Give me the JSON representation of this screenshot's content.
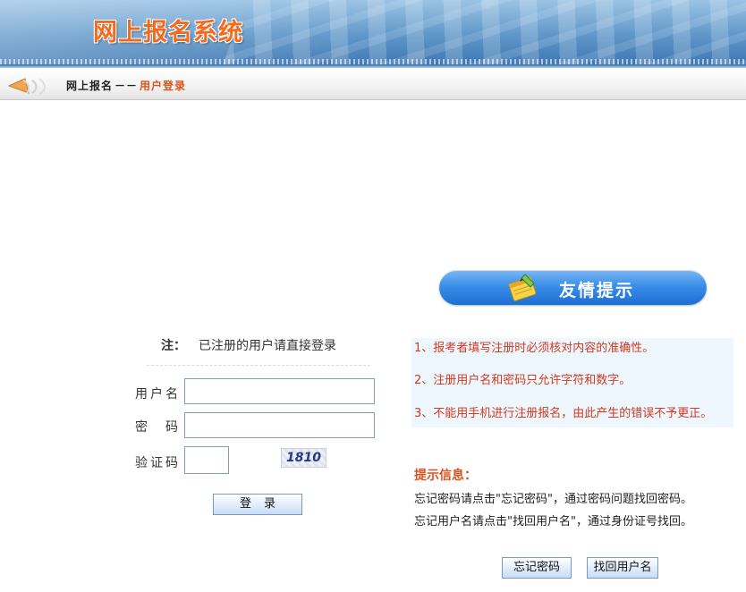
{
  "header": {
    "title": "网上报名系统"
  },
  "breadcrumb": {
    "root": "网上报名",
    "separator": "－－",
    "current": "用户登录"
  },
  "tips_panel": {
    "title": "友情提示",
    "items": [
      "1、报考者填写注册时必须核对内容的准确性。",
      "2、注册用户名和密码只允许字符和数字。",
      "3、不能用手机进行注册报名，由此产生的错误不予更正。"
    ]
  },
  "login_form": {
    "note_label": "注：",
    "note_text": "已注册的用户请直接登录",
    "username_label": "用户名",
    "username_value": "",
    "password_label": "密　码",
    "password_value": "",
    "captcha_label": "验证码",
    "captcha_value": "",
    "captcha_image_text": "1810",
    "login_button": "登录"
  },
  "info": {
    "title": "提示信息：",
    "line1": "忘记密码请点击\"忘记密码\"，通过密码问题找回密码。",
    "line2": "忘记用户名请点击\"找回用户名\"，通过身份证号找回。",
    "forgot_password_button": "忘记密码",
    "find_username_button": "找回用户名"
  },
  "colors": {
    "title_orange": "#f46a1d",
    "tip_red": "#d23a1e",
    "pill_blue": "#3a8ee8"
  }
}
